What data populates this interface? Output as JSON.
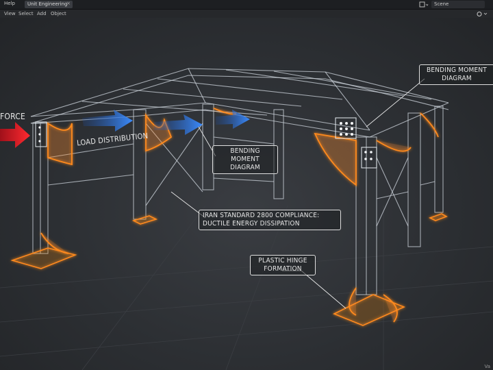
{
  "menubar": {
    "help": "Help"
  },
  "workspace_tab": {
    "label": "Unit Engineering",
    "close": "×"
  },
  "scene": {
    "label": "Scene"
  },
  "viewport_header": {
    "view": "View",
    "select": "Select",
    "add": "Add",
    "object": "Object"
  },
  "annotations": {
    "force_left": "FORCE",
    "load_distribution": "LOAD DISTRIBUTION",
    "bending_moment_center": "BENDING MOMENT\nDIAGRAM",
    "bending_moment_right": "BENDING MOMENT\nDIAGRAM",
    "iran_standard": "IRAN STANDARD 2800 COMPLIANCE:\nDUCTILE ENERGY DISSIPATION",
    "plastic_hinge": "PLASTIC HINGE\nFORMATION"
  },
  "status": {
    "version": "Va"
  },
  "colors": {
    "accent_orange": "#ff8a1e",
    "arrow_blue": "#2f7fe6",
    "arrow_red": "#e0202a",
    "wireframe": "#cfd6de"
  }
}
